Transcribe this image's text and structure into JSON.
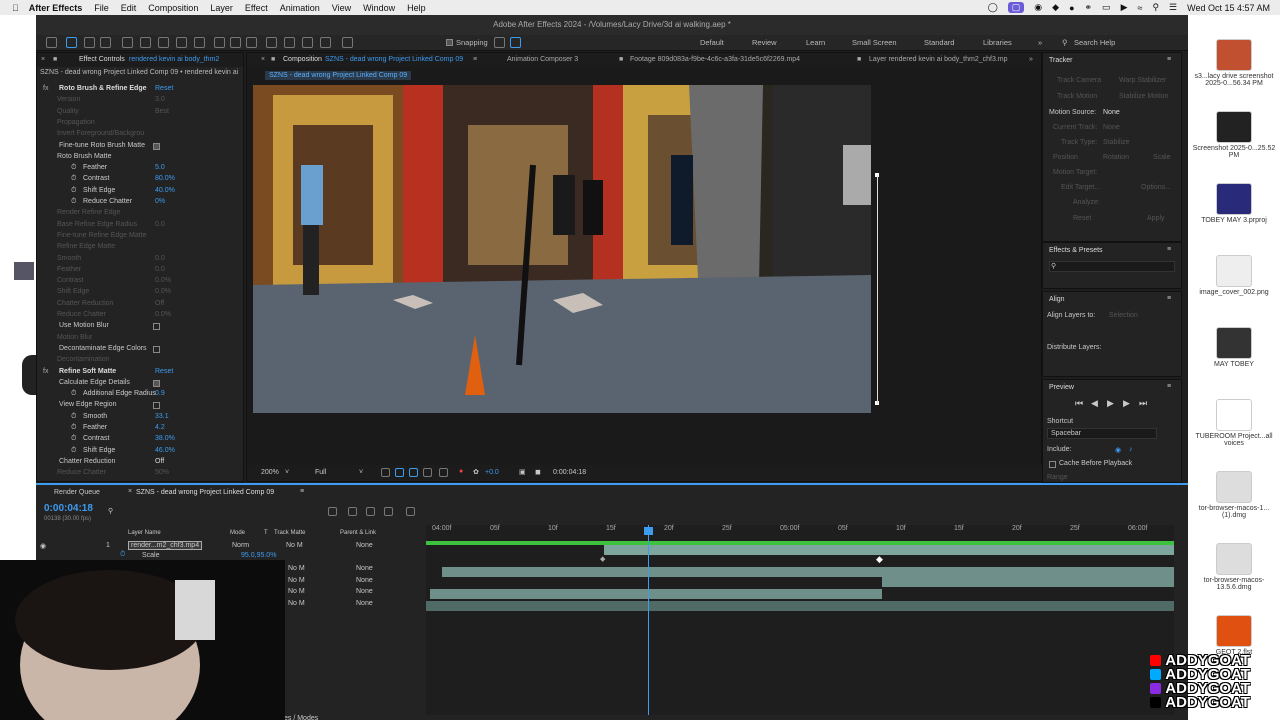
{
  "menubar": {
    "app_name": "After Effects",
    "items": [
      "File",
      "Edit",
      "Composition",
      "Layer",
      "Effect",
      "Animation",
      "View",
      "Window",
      "Help"
    ],
    "datetime": "Wed Oct 15  4:57 AM"
  },
  "window_title": "Adobe After Effects 2024 - /Volumes/Lacy Drive/3d ai walking.aep *",
  "toolbar": {
    "snapping_label": "Snapping",
    "workspaces": [
      "Default",
      "Review",
      "Learn",
      "Small Screen",
      "Standard",
      "Libraries"
    ],
    "search_placeholder": "Search Help"
  },
  "effect_controls": {
    "tab_label": "Effect Controls",
    "tab_layer": "rendered kevin ai body_thm2",
    "subtitle": "SZNS - dead wrong Project Linked Comp 09 • rendered kevin ai",
    "rows": [
      {
        "label": "Roto Brush & Refine Edge",
        "value": "Reset",
        "state": "fx"
      },
      {
        "label": "Version",
        "value": "3.0",
        "state": "dim"
      },
      {
        "label": "Quality",
        "value": "Best",
        "state": "dim"
      },
      {
        "label": "Propagation",
        "value": "",
        "state": "dim"
      },
      {
        "label": "Invert Foreground/Backgrou",
        "value": "",
        "state": "dim"
      },
      {
        "label": "Fine-tune Roto Brush Matte",
        "value": "",
        "state": "check"
      },
      {
        "label": "Roto Brush Matte",
        "value": "",
        "state": "group"
      },
      {
        "label": "Feather",
        "value": "5.0",
        "state": "prop"
      },
      {
        "label": "Contrast",
        "value": "80.0%",
        "state": "prop"
      },
      {
        "label": "Shift Edge",
        "value": "40.0%",
        "state": "prop"
      },
      {
        "label": "Reduce Chatter",
        "value": "0%",
        "state": "prop"
      },
      {
        "label": "Render Refine Edge",
        "value": "",
        "state": "dim"
      },
      {
        "label": "Base Refine Edge Radius",
        "value": "0.0",
        "state": "dim"
      },
      {
        "label": "Fine-tune Refine Edge Matte",
        "value": "",
        "state": "dim"
      },
      {
        "label": "Refine Edge Matte",
        "value": "",
        "state": "dim"
      },
      {
        "label": "Smooth",
        "value": "0.0",
        "state": "dim"
      },
      {
        "label": "Feather",
        "value": "0.0",
        "state": "dim"
      },
      {
        "label": "Contrast",
        "value": "0.0%",
        "state": "dim"
      },
      {
        "label": "Shift Edge",
        "value": "0.0%",
        "state": "dim"
      },
      {
        "label": "Chatter Reduction",
        "value": "Off",
        "state": "dim"
      },
      {
        "label": "Reduce Chatter",
        "value": "0.0%",
        "state": "dim"
      },
      {
        "label": "Use Motion Blur",
        "value": "",
        "state": "checkoff"
      },
      {
        "label": "Motion Blur",
        "value": "",
        "state": "dim"
      },
      {
        "label": "Decontaminate Edge Colors",
        "value": "",
        "state": "checkoff"
      },
      {
        "label": "Decontamination",
        "value": "",
        "state": "dim"
      },
      {
        "label": "Refine Soft Matte",
        "value": "Reset",
        "state": "fx"
      },
      {
        "label": "Calculate Edge Details",
        "value": "",
        "state": "check"
      },
      {
        "label": "Additional Edge Radius",
        "value": "0.9",
        "state": "prop"
      },
      {
        "label": "View Edge Region",
        "value": "",
        "state": "checkoff"
      },
      {
        "label": "Smooth",
        "value": "33.1",
        "state": "prop"
      },
      {
        "label": "Feather",
        "value": "4.2",
        "state": "prop"
      },
      {
        "label": "Contrast",
        "value": "38.0%",
        "state": "prop"
      },
      {
        "label": "Shift Edge",
        "value": "46.0%",
        "state": "prop"
      },
      {
        "label": "Chatter Reduction",
        "value": "Off",
        "state": "select"
      },
      {
        "label": "Reduce Chatter",
        "value": "50%",
        "state": "dim"
      }
    ]
  },
  "composition": {
    "tab_label": "Composition",
    "tab_comp": "SZNS - dead wrong Project Linked Comp 09",
    "other_tabs": [
      "Animation Composer 3",
      "Footage 809d083a-f9be-4c6c-a3fa-31de5c6f2269.mp4",
      "Layer rendered kevin ai body_thm2_chf3.mp"
    ],
    "breadcrumb": "SZNS - dead wrong Project Linked Comp 09",
    "zoom": "200%",
    "resolution": "Full",
    "exposure": "+0.0",
    "timecode": "0:00:04:18"
  },
  "tracker": {
    "title": "Tracker",
    "buttons": [
      "Track Camera",
      "Warp Stabilizer",
      "Track Motion",
      "Stabilize Motion"
    ],
    "motion_source_label": "Motion Source:",
    "motion_source_value": "None",
    "current_track_label": "Current Track:",
    "current_track_value": "None",
    "track_type_label": "Track Type:",
    "track_type_value": "Stabilize",
    "options": [
      "Position",
      "Rotation",
      "Scale"
    ],
    "motion_target": "Motion Target:",
    "edit_target": "Edit Target...",
    "options_btn": "Options...",
    "analyze": "Analyze:",
    "reset": "Reset",
    "apply": "Apply"
  },
  "effects_presets": {
    "title": "Effects & Presets"
  },
  "align": {
    "title": "Align",
    "align_to_label": "Align Layers to:",
    "align_to_value": "Selection",
    "distribute": "Distribute Layers:"
  },
  "preview": {
    "title": "Preview",
    "shortcut_label": "Shortcut",
    "shortcut_value": "Spacebar",
    "include_label": "Include:",
    "cache_label": "Cache Before Playback",
    "range_label": "Range"
  },
  "timeline": {
    "tabs": [
      "Render Queue",
      "SZNS - dead wrong Project Linked Comp 09"
    ],
    "timecode": "0:00:04:18",
    "frames": "00138 (30.00 fps)",
    "col_headers": [
      "Layer Name",
      "Mode",
      "T",
      "Track Matte",
      "Parent & Link"
    ],
    "layer": {
      "num": "1",
      "name": "render...m2_chf3.mp4",
      "mode": "Norm",
      "matte": "No M",
      "parent": "None"
    },
    "scale_label": "Scale",
    "scale_value": "95.0,95.0%",
    "sub_rows": [
      {
        "matte": "No M",
        "parent": "None"
      },
      {
        "matte": "No M",
        "parent": "None"
      },
      {
        "matte": "No M",
        "parent": "None"
      },
      {
        "matte": "No M",
        "parent": "None"
      }
    ],
    "ruler": [
      "04:00f",
      "05f",
      "10f",
      "15f",
      "20f",
      "25f",
      "05:00f",
      "05f",
      "10f",
      "15f",
      "20f",
      "25f",
      "06:00f"
    ],
    "footer_label": "es / Modes"
  },
  "desktop": {
    "items": [
      {
        "label": "s3...lacy drive screenshot 2025-0...56.34 PM",
        "color": "#c05030"
      },
      {
        "label": "Screenshot 2025-0...25.52 PM",
        "color": "#222222"
      },
      {
        "label": "TOBEY MAY 3.prproj",
        "color": "#2a2a7a"
      },
      {
        "label": "image_cover_002.png",
        "color": "#eeeeee"
      },
      {
        "label": "MAY TOBEY",
        "color": "#333333"
      },
      {
        "label": "TUBEROOM Project...all voices",
        "color": "#ffffff"
      },
      {
        "label": "tor-browser-macos-1...(1).dmg",
        "color": "#dddddd"
      },
      {
        "label": "tor-browser-macos-13.5.6.dmg",
        "color": "#dddddd"
      },
      {
        "label": "GEOT 2.flst",
        "color": "#e05010"
      }
    ]
  },
  "overlay": {
    "handles": [
      "ADDYGOAT",
      "ADDYGOAT",
      "ADDYGOAT",
      "ADDYGOAT"
    ],
    "handle_colors": [
      "#ff0000",
      "#00aaff",
      "#8a2be2",
      "#000000"
    ]
  }
}
